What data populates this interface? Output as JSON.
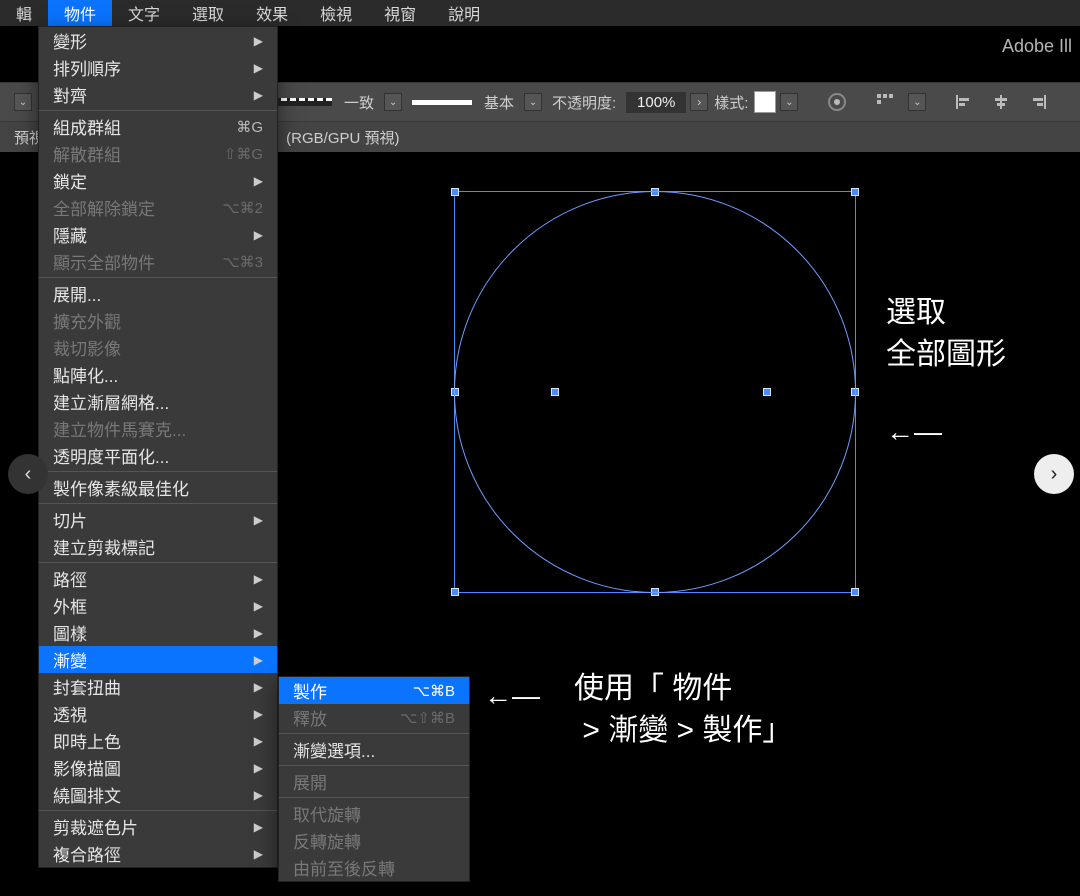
{
  "menubar": {
    "items": [
      "輯",
      "物件",
      "文字",
      "選取",
      "效果",
      "檢視",
      "視窗",
      "說明"
    ],
    "active_index": 1
  },
  "app_title": "Adobe Ill",
  "controlbar": {
    "stroke_style1": "一致",
    "stroke_style2": "基本",
    "opacity_label": "不透明度:",
    "opacity_value": "100%",
    "style_label": "樣式:"
  },
  "tab": {
    "left": "預視]",
    "mode": "(RGB/GPU 預視)"
  },
  "annotations": {
    "top": "選取\n全部圖形",
    "top_arrow": "←—",
    "bottom_arrow": "←—",
    "bottom": "使用「 物件\n > 漸變 > 製作」"
  },
  "object_menu": {
    "items": [
      {
        "label": "變形",
        "submenu": true,
        "disabled": false,
        "shortcut": ""
      },
      {
        "label": "排列順序",
        "submenu": true,
        "disabled": false,
        "shortcut": ""
      },
      {
        "label": "對齊",
        "submenu": true,
        "disabled": false,
        "shortcut": ""
      },
      {
        "sep": true
      },
      {
        "label": "組成群組",
        "submenu": false,
        "disabled": false,
        "shortcut": "⌘G"
      },
      {
        "label": "解散群組",
        "submenu": false,
        "disabled": true,
        "shortcut": "⇧⌘G"
      },
      {
        "label": "鎖定",
        "submenu": true,
        "disabled": false,
        "shortcut": ""
      },
      {
        "label": "全部解除鎖定",
        "submenu": false,
        "disabled": true,
        "shortcut": "⌥⌘2"
      },
      {
        "label": "隱藏",
        "submenu": true,
        "disabled": false,
        "shortcut": ""
      },
      {
        "label": "顯示全部物件",
        "submenu": false,
        "disabled": true,
        "shortcut": "⌥⌘3"
      },
      {
        "sep": true
      },
      {
        "label": "展開...",
        "submenu": false,
        "disabled": false,
        "shortcut": ""
      },
      {
        "label": "擴充外觀",
        "submenu": false,
        "disabled": true,
        "shortcut": ""
      },
      {
        "label": "裁切影像",
        "submenu": false,
        "disabled": true,
        "shortcut": ""
      },
      {
        "label": "點陣化...",
        "submenu": false,
        "disabled": false,
        "shortcut": ""
      },
      {
        "label": "建立漸層網格...",
        "submenu": false,
        "disabled": false,
        "shortcut": ""
      },
      {
        "label": "建立物件馬賽克...",
        "submenu": false,
        "disabled": true,
        "shortcut": ""
      },
      {
        "label": "透明度平面化...",
        "submenu": false,
        "disabled": false,
        "shortcut": ""
      },
      {
        "sep": true
      },
      {
        "label": "製作像素級最佳化",
        "submenu": false,
        "disabled": false,
        "shortcut": ""
      },
      {
        "sep": true
      },
      {
        "label": "切片",
        "submenu": true,
        "disabled": false,
        "shortcut": ""
      },
      {
        "label": "建立剪裁標記",
        "submenu": false,
        "disabled": false,
        "shortcut": ""
      },
      {
        "sep": true
      },
      {
        "label": "路徑",
        "submenu": true,
        "disabled": false,
        "shortcut": ""
      },
      {
        "label": "外框",
        "submenu": true,
        "disabled": false,
        "shortcut": ""
      },
      {
        "label": "圖樣",
        "submenu": true,
        "disabled": false,
        "shortcut": ""
      },
      {
        "label": "漸變",
        "submenu": true,
        "disabled": false,
        "shortcut": "",
        "highlight": true
      },
      {
        "label": "封套扭曲",
        "submenu": true,
        "disabled": false,
        "shortcut": ""
      },
      {
        "label": "透視",
        "submenu": true,
        "disabled": false,
        "shortcut": ""
      },
      {
        "label": "即時上色",
        "submenu": true,
        "disabled": false,
        "shortcut": ""
      },
      {
        "label": "影像描圖",
        "submenu": true,
        "disabled": false,
        "shortcut": ""
      },
      {
        "label": "繞圖排文",
        "submenu": true,
        "disabled": false,
        "shortcut": ""
      },
      {
        "sep": true
      },
      {
        "label": "剪裁遮色片",
        "submenu": true,
        "disabled": false,
        "shortcut": ""
      },
      {
        "label": "複合路徑",
        "submenu": true,
        "disabled": false,
        "shortcut": ""
      }
    ]
  },
  "blend_submenu": {
    "items": [
      {
        "label": "製作",
        "shortcut": "⌥⌘B",
        "disabled": false,
        "highlight": true
      },
      {
        "label": "釋放",
        "shortcut": "⌥⇧⌘B",
        "disabled": true
      },
      {
        "sep": true
      },
      {
        "label": "漸變選項...",
        "shortcut": "",
        "disabled": false
      },
      {
        "sep": true
      },
      {
        "label": "展開",
        "shortcut": "",
        "disabled": true
      },
      {
        "sep": true
      },
      {
        "label": "取代旋轉",
        "shortcut": "",
        "disabled": true
      },
      {
        "label": "反轉旋轉",
        "shortcut": "",
        "disabled": true
      },
      {
        "label": "由前至後反轉",
        "shortcut": "",
        "disabled": true
      }
    ]
  }
}
